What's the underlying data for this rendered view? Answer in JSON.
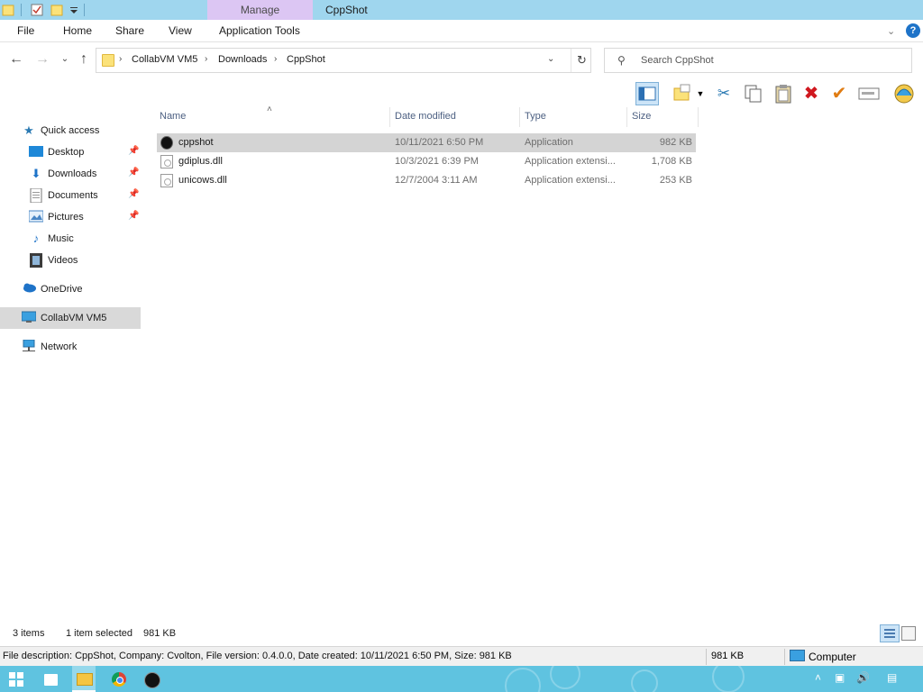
{
  "window": {
    "title": "CppShot",
    "contextual_tab": "Manage"
  },
  "ribbon": {
    "tabs": [
      "File",
      "Home",
      "Share",
      "View",
      "Application Tools"
    ]
  },
  "address": {
    "breadcrumbs": [
      "CollabVM VM5",
      "Downloads",
      "CppShot"
    ],
    "search_placeholder": "Search CppShot"
  },
  "toolbar": {
    "icons": [
      "layout-pane-icon",
      "new-folder-icon",
      "cut-icon",
      "copy-icon",
      "paste-icon",
      "delete-icon",
      "check-icon",
      "rename-icon",
      "shell-icon"
    ]
  },
  "nav": {
    "items": [
      {
        "label": "Quick access",
        "icon": "star-icon"
      },
      {
        "label": "Desktop",
        "icon": "desktop-icon"
      },
      {
        "label": "Downloads",
        "icon": "download-icon"
      },
      {
        "label": "Documents",
        "icon": "document-icon"
      },
      {
        "label": "Pictures",
        "icon": "picture-icon"
      },
      {
        "label": "Music",
        "icon": "music-icon"
      },
      {
        "label": "Videos",
        "icon": "video-icon"
      },
      {
        "label": "OneDrive",
        "icon": "cloud-icon"
      },
      {
        "label": "CollabVM VM5",
        "icon": "computer-icon"
      },
      {
        "label": "Network",
        "icon": "network-icon"
      }
    ]
  },
  "files": {
    "columns": [
      "Name",
      "Date modified",
      "Type",
      "Size"
    ],
    "rows": [
      {
        "name": "cppshot",
        "date": "10/11/2021 6:50 PM",
        "type": "Application",
        "size": "982 KB"
      },
      {
        "name": "gdiplus.dll",
        "date": "10/3/2021 6:39 PM",
        "type": "Application extensi...",
        "size": "1,708 KB"
      },
      {
        "name": "unicows.dll",
        "date": "12/7/2004 3:11 AM",
        "type": "Application extensi...",
        "size": "253 KB"
      }
    ]
  },
  "status": {
    "item_count": "3 items",
    "selection": "1 item selected",
    "selection_size": "981 KB"
  },
  "details": {
    "description": "File description: CppShot, Company: Cvolton, File version: 0.4.0.0, Date created: 10/11/2021 6:50 PM, Size: 981 KB",
    "size": "981 KB",
    "location": "Computer"
  }
}
